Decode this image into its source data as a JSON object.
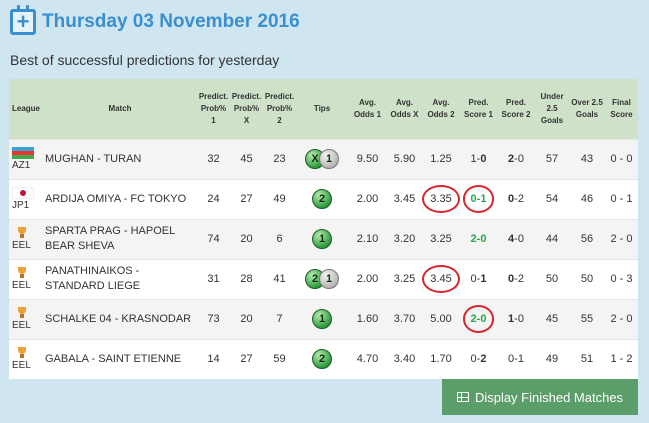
{
  "header": {
    "title": "Thursday 03 November 2016",
    "subtitle": "Best of successful predictions for yesterday"
  },
  "columns": {
    "league": "League",
    "match": "Match",
    "p1": [
      "Predict.",
      "Prob%",
      "1"
    ],
    "px": [
      "Predict.",
      "Prob%",
      "X"
    ],
    "p2": [
      "Predict.",
      "Prob%",
      "2"
    ],
    "tips": "Tips",
    "o1": [
      "Avg.",
      "Odds 1"
    ],
    "ox": [
      "Avg.",
      "Odds X"
    ],
    "o2": [
      "Avg.",
      "Odds 2"
    ],
    "s1": [
      "Pred.",
      "Score 1"
    ],
    "s2": [
      "Pred.",
      "Score 2"
    ],
    "u25": [
      "Under",
      "2.5 Goals"
    ],
    "o25": [
      "Over 2.5",
      "Goals"
    ],
    "fs": [
      "Final",
      "Score"
    ]
  },
  "rows": [
    {
      "league": "AZ1",
      "flag": "azerbaijan-flag",
      "match": "MUGHAN - TURAN",
      "p1": "32",
      "px": "45",
      "p2": "23",
      "tips": [
        "X",
        "1"
      ],
      "o1": "9.50",
      "ox": "5.90",
      "o2": "1.25",
      "s1a": "1",
      "s1b": "0",
      "s2a": "2",
      "s2b": "0",
      "u25": "57",
      "o25": "43",
      "fs": "0 - 0"
    },
    {
      "league": "JP1",
      "flag": "japan-flag",
      "match": "ARDIJA OMIYA - FC TOKYO",
      "p1": "24",
      "px": "27",
      "p2": "49",
      "tips": [
        "2"
      ],
      "o1": "2.00",
      "ox": "3.45",
      "o2": "3.35",
      "s1": "0-1",
      "s2a": "0",
      "s2b": "2",
      "u25": "54",
      "o25": "46",
      "fs": "0 - 1"
    },
    {
      "league": "EEL",
      "flag": "trophy",
      "match": "SPARTA PRAG - HAPOEL BEAR SHEVA",
      "p1": "74",
      "px": "20",
      "p2": "6",
      "tips": [
        "1"
      ],
      "o1": "2.10",
      "ox": "3.20",
      "o2": "3.25",
      "s1": "2-0",
      "s2a": "4",
      "s2b": "0",
      "u25": "44",
      "o25": "56",
      "fs": "2 - 0"
    },
    {
      "league": "EEL",
      "flag": "trophy",
      "match": "PANATHINAIKOS - STANDARD LIEGE",
      "p1": "31",
      "px": "28",
      "p2": "41",
      "tips": [
        "2",
        "1"
      ],
      "o1": "2.00",
      "ox": "3.25",
      "o2": "3.45",
      "s1a": "0",
      "s1b": "1",
      "s2a": "0",
      "s2b": "2",
      "u25": "50",
      "o25": "50",
      "fs": "0 - 3"
    },
    {
      "league": "EEL",
      "flag": "trophy",
      "match": "SCHALKE 04 - KRASNODAR",
      "p1": "73",
      "px": "20",
      "p2": "7",
      "tips": [
        "1"
      ],
      "o1": "1.60",
      "ox": "3.70",
      "o2": "5.00",
      "s1": "2-0",
      "s2a": "1",
      "s2b": "0",
      "u25": "45",
      "o25": "55",
      "fs": "2 - 0"
    },
    {
      "league": "EEL",
      "flag": "trophy",
      "match": "GABALA - SAINT ETIENNE",
      "p1": "14",
      "px": "27",
      "p2": "59",
      "tips": [
        "2"
      ],
      "o1": "4.70",
      "ox": "3.40",
      "o2": "1.70",
      "s1a": "0",
      "s1b": "2",
      "s2": "0-1",
      "u25": "49",
      "o25": "51",
      "fs": "1 - 2"
    }
  ],
  "button": {
    "label": "Display Finished Matches"
  }
}
